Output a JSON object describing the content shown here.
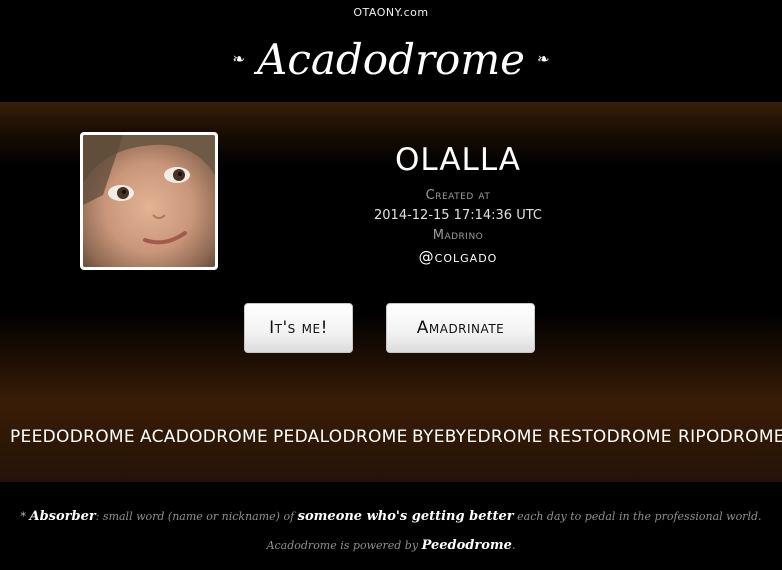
{
  "header": {
    "site_link": "OTAONY.com",
    "brand_title": "Acadodrome",
    "fleuron_left": "❧",
    "fleuron_right": "❧"
  },
  "profile": {
    "name": "OLALLA",
    "created_label": "Created at",
    "created_value": "2014-12-15 17:14:36 UTC",
    "role_label": "Madrino",
    "handle": "@colgado"
  },
  "actions": {
    "its_me": "It's me!",
    "amadrinate": "Amadrinate"
  },
  "nav": {
    "items": [
      "PEEDODROME",
      "ACADODROME",
      "PEDALODROME",
      "BYEBYEDROME",
      "RESTODROME",
      "RIPODROME"
    ]
  },
  "footer": {
    "asterisk": "*",
    "absorber": "Absorber",
    "definition_start": ": small word (name or nickname) of ",
    "someone": "someone who's getting better",
    "definition_end": " each day to pedal in the professional world.",
    "powered_start": "Acadodrome is powered by ",
    "powered_brand": "Peedodrome",
    "powered_end": "."
  }
}
